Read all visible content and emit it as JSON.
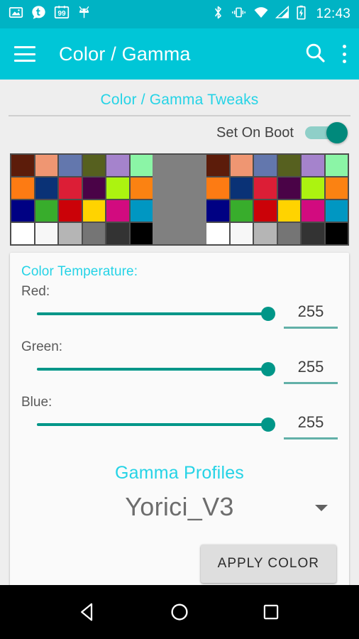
{
  "statusbar": {
    "background": "#00b3c4",
    "clock": "12:43",
    "left_icons": [
      "image-icon",
      "tumblr-icon",
      "badge-99-icon",
      "android-head-icon"
    ],
    "right_icons": [
      "bluetooth-icon",
      "vibrate-icon",
      "wifi-icon",
      "signal-icon",
      "battery-charging-icon"
    ],
    "badge_count": "99"
  },
  "appbar": {
    "background": "#00c6d7",
    "title": "Color / Gamma",
    "menu_icon": "hamburger-menu-icon",
    "search_icon": "search-icon",
    "overflow_icon": "overflow-menu-icon"
  },
  "content": {
    "section_title": "Color / Gamma Tweaks",
    "set_on_boot": {
      "label": "Set On Boot",
      "enabled": true,
      "on_color": "#00897b",
      "track_color": "#8fcfc8"
    }
  },
  "swatches": {
    "frame_color": "#808080",
    "border_color": "#4d4d4d",
    "rows": [
      [
        "#5c1c0a",
        "#ef9672",
        "#6377ad",
        "#56601f",
        "#a583cc",
        "#8bf5a6"
      ],
      [
        "#fd7b13",
        "#0a3276",
        "#dc1e36",
        "#4a0347",
        "#acf310",
        "#fb8212"
      ],
      [
        "#000183",
        "#38ad2c",
        "#cb0208",
        "#ffd300",
        "#d20b7f",
        "#0097c2"
      ],
      [
        "#ffffff",
        "#f7f7f7",
        "#b5b5b5",
        "#757575",
        "#333333",
        "#000000"
      ]
    ]
  },
  "color_temperature": {
    "heading": "Color Temperature:",
    "channels": [
      {
        "label": "Red:",
        "value": "255",
        "percent": 100
      },
      {
        "label": "Green:",
        "value": "255",
        "percent": 100
      },
      {
        "label": "Blue:",
        "value": "255",
        "percent": 100
      }
    ],
    "slider_color": "#009688",
    "underline_color": "#62b0a8"
  },
  "gamma_profiles": {
    "title": "Gamma Profiles",
    "selected": "Yorici_V3",
    "caret_icon": "chevron-down-icon"
  },
  "actions": {
    "apply_label": "APPLY COLOR"
  },
  "navbar": {
    "background": "#000000",
    "back_icon": "back-triangle-icon",
    "home_icon": "home-circle-icon",
    "recents_icon": "recents-square-icon"
  }
}
